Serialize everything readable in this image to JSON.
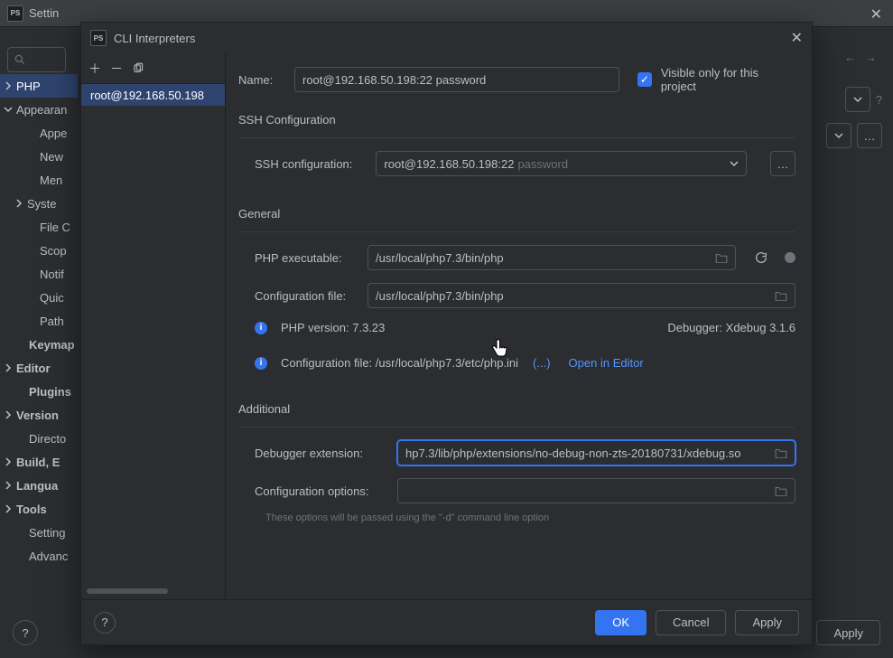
{
  "bg": {
    "title": "Settin",
    "search_placeholder": "",
    "tree": [
      {
        "label": "PHP",
        "chev": ">",
        "selected": true
      },
      {
        "label": "Appearan",
        "chev": "v"
      },
      {
        "label": "Appe",
        "indent": 2
      },
      {
        "label": "New",
        "indent": 2
      },
      {
        "label": "Men",
        "indent": 2
      },
      {
        "label": "Syste",
        "chev": ">",
        "indent": 1
      },
      {
        "label": "File C",
        "indent": 2
      },
      {
        "label": "Scop",
        "indent": 2
      },
      {
        "label": "Notif",
        "indent": 2
      },
      {
        "label": "Quic",
        "indent": 2
      },
      {
        "label": "Path",
        "indent": 2
      },
      {
        "label": "Keymap",
        "bold": true,
        "indent": 1
      },
      {
        "label": "Editor",
        "chev": ">",
        "bold": true,
        "indent": 0
      },
      {
        "label": "Plugins",
        "bold": true,
        "indent": 1
      },
      {
        "label": "Version",
        "chev": ">",
        "bold": true,
        "indent": 0
      },
      {
        "label": "Directo",
        "indent": 1
      },
      {
        "label": "Build, E",
        "chev": ">",
        "bold": true,
        "indent": 0
      },
      {
        "label": "Langua",
        "chev": ">",
        "bold": true,
        "indent": 0
      },
      {
        "label": "Tools",
        "chev": ">",
        "bold": true,
        "indent": 0
      },
      {
        "label": "Setting",
        "indent": 1
      },
      {
        "label": "Advanc",
        "indent": 1
      }
    ],
    "apply_label": "Apply"
  },
  "dialog": {
    "title": "CLI Interpreters",
    "list_selected": "root@192.168.50.198",
    "name_label": "Name:",
    "name_value": "root@192.168.50.198:22 password",
    "visible_label": "Visible only for this project",
    "ssh_section": "SSH Configuration",
    "ssh_label": "SSH configuration:",
    "ssh_value": "root@192.168.50.198:22",
    "ssh_hint": "password",
    "general_section": "General",
    "php_exec_label": "PHP executable:",
    "php_exec_value": "/usr/local/php7.3/bin/php",
    "conf_file_label": "Configuration file:",
    "conf_file_value": "/usr/local/php7.3/bin/php",
    "php_version_label": "PHP version: 7.3.23",
    "debugger_label": "Debugger: Xdebug 3.1.6",
    "conf_file_info": "Configuration file: /usr/local/php7.3/etc/php.ini",
    "ellipsis_link": "(...)",
    "open_editor": "Open in Editor",
    "additional_section": "Additional",
    "dbg_ext_label": "Debugger extension:",
    "dbg_ext_value": "hp7.3/lib/php/extensions/no-debug-non-zts-20180731/xdebug.so",
    "conf_opts_label": "Configuration options:",
    "conf_opts_value": "",
    "hint": "These options will be passed using the \"-d\" command line option",
    "ok_label": "OK",
    "cancel_label": "Cancel",
    "apply_label": "Apply"
  }
}
